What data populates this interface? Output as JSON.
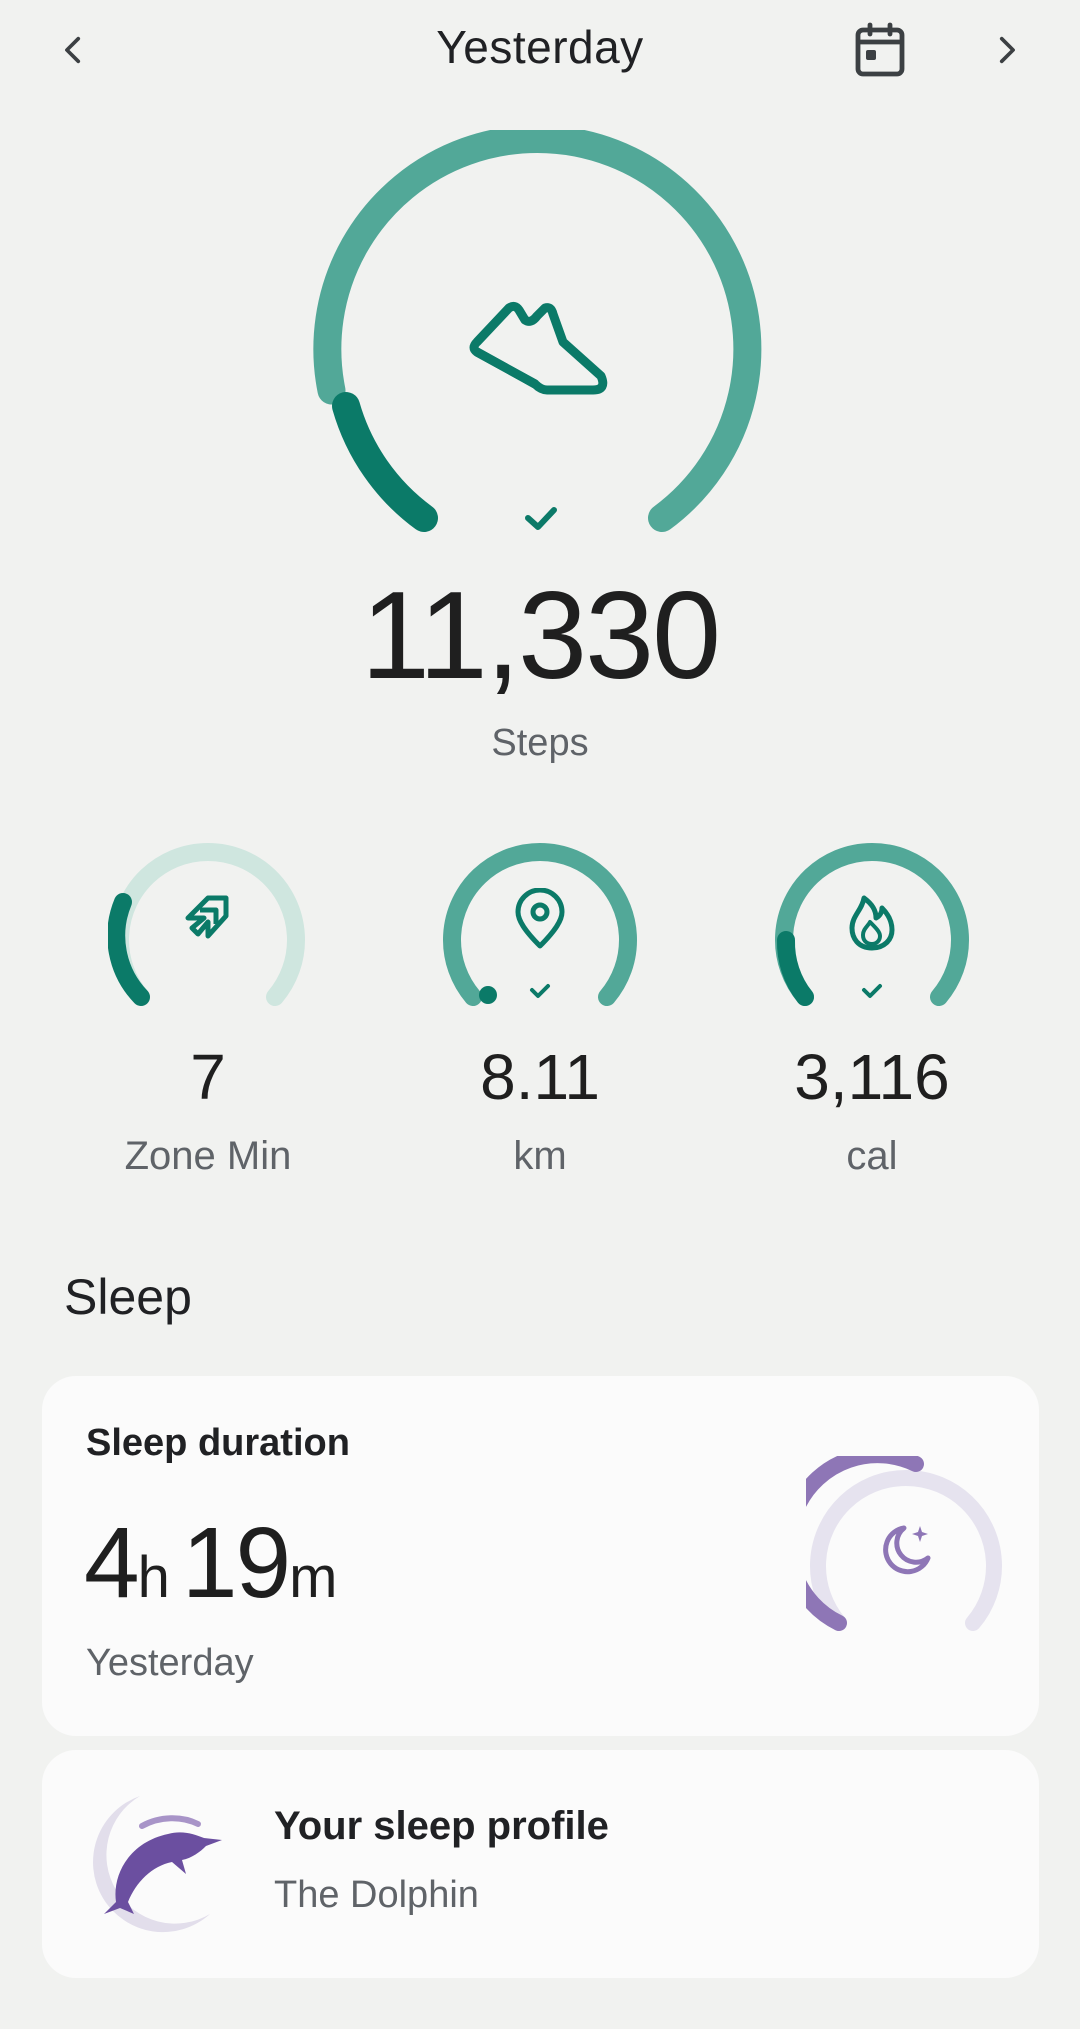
{
  "header": {
    "title": "Yesterday",
    "prev_icon": "chevron-left-icon",
    "next_icon": "chevron-right-icon",
    "calendar_icon": "calendar-icon"
  },
  "steps": {
    "value": "11,330",
    "label": "Steps",
    "icon": "shoe-icon",
    "goal_met": true,
    "progress": 1.0
  },
  "metrics": [
    {
      "value": "7",
      "label": "Zone Min",
      "icon": "zone-arrows-icon",
      "progress": 0.25,
      "goal_met": false
    },
    {
      "value": "8.11",
      "label": "km",
      "icon": "location-pin-icon",
      "progress": 1.0,
      "goal_met": true
    },
    {
      "value": "3,116",
      "label": "cal",
      "icon": "flame-icon",
      "progress": 1.0,
      "goal_met": true
    }
  ],
  "sleep": {
    "section_title": "Sleep",
    "duration_title": "Sleep duration",
    "hours": "4",
    "hours_unit": "h",
    "minutes": "19",
    "minutes_unit": "m",
    "date": "Yesterday",
    "icon": "moon-stars-icon",
    "progress": 0.55,
    "profile_title": "Your sleep profile",
    "profile_value": "The Dolphin",
    "profile_icon": "dolphin-icon"
  },
  "colors": {
    "teal_light": "#52a898",
    "teal_dark": "#0b7a68",
    "teal_pale": "#cfe6df",
    "purple": "#8e76b6",
    "purple_pale": "#e6e3ef",
    "background": "#f1f2f0",
    "card": "#fbfbfb"
  }
}
